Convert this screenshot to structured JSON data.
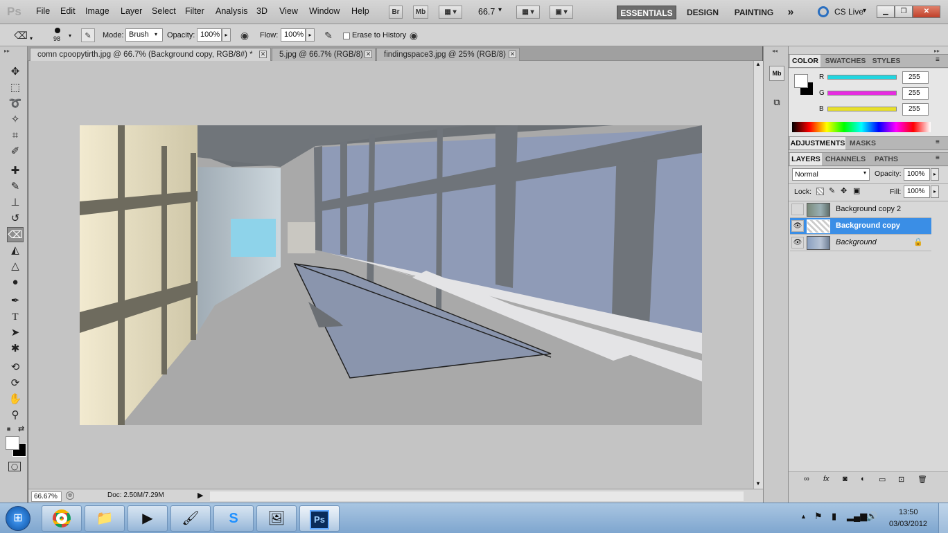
{
  "menubar": {
    "logo": "Ps",
    "items": [
      "File",
      "Edit",
      "Image",
      "Layer",
      "Select",
      "Filter",
      "Analysis",
      "3D",
      "View",
      "Window",
      "Help"
    ],
    "bridge_label": "Br",
    "minibridge_label": "Mb",
    "zoom": "66.7",
    "workspaces": [
      "ESSENTIALS",
      "DESIGN",
      "PAINTING"
    ],
    "more": "»",
    "cs_live": "CS Live"
  },
  "options": {
    "brush_size": "98",
    "mode_label": "Mode:",
    "mode_value": "Brush",
    "opacity_label": "Opacity:",
    "opacity_value": "100%",
    "flow_label": "Flow:",
    "flow_value": "100%",
    "erase_history_label": "Erase to History"
  },
  "tabs": [
    {
      "label": "comn cpoopytirth.jpg @ 66.7% (Background copy, RGB/8#) *",
      "active": true
    },
    {
      "label": "5.jpg @ 66.7% (RGB/8)",
      "active": false
    },
    {
      "label": "findingspace3.jpg @ 25% (RGB/8)",
      "active": false
    }
  ],
  "status": {
    "zoom": "66.67%",
    "doc": "Doc: 2.50M/7.29M"
  },
  "color_panel": {
    "tabs": [
      "COLOR",
      "SWATCHES",
      "STYLES"
    ],
    "channels": [
      {
        "label": "R",
        "value": "255",
        "color": "#22d6e0"
      },
      {
        "label": "G",
        "value": "255",
        "color": "#e62ce0"
      },
      {
        "label": "B",
        "value": "255",
        "color": "#e8e02a"
      }
    ]
  },
  "adjust_panel": {
    "tabs": [
      "ADJUSTMENTS",
      "MASKS"
    ]
  },
  "layers_panel": {
    "tabs": [
      "LAYERS",
      "CHANNELS",
      "PATHS"
    ],
    "blend_mode": "Normal",
    "opacity_label": "Opacity:",
    "opacity_value": "100%",
    "lock_label": "Lock:",
    "fill_label": "Fill:",
    "fill_value": "100%",
    "layers": [
      {
        "name": "Background copy 2",
        "visible": false,
        "selected": false
      },
      {
        "name": "Background copy",
        "visible": true,
        "selected": true
      },
      {
        "name": "Background",
        "visible": true,
        "selected": false,
        "locked": true
      }
    ]
  },
  "taskbar": {
    "time": "13:50",
    "date": "03/03/2012",
    "apps": [
      "chrome-icon",
      "explorer-icon",
      "media-player-icon",
      "paint-icon",
      "skype-icon",
      "photo-viewer-icon",
      "photoshop-icon"
    ],
    "photoshop_label": "Ps"
  }
}
